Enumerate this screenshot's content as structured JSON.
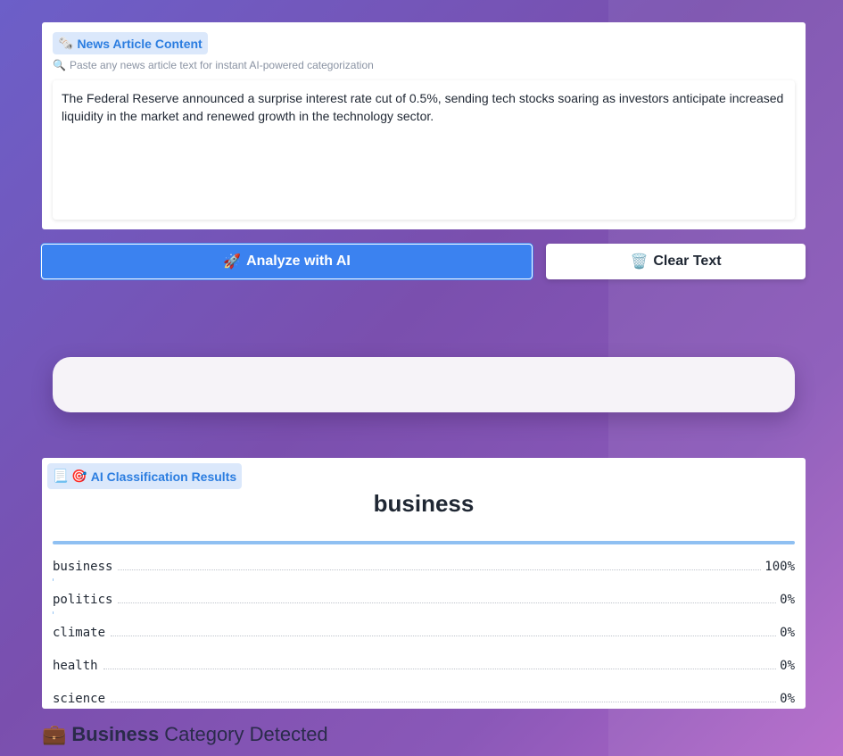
{
  "input": {
    "label_icon": "🗞️",
    "label": "News Article Content",
    "hint_icon": "🔍",
    "hint": "Paste any news article text for instant AI-powered categorization",
    "text": "The Federal Reserve announced a surprise interest rate cut of 0.5%, sending tech stocks soaring as investors anticipate increased liquidity in the market and renewed growth in the technology sector."
  },
  "actions": {
    "analyze_icon": "🚀",
    "analyze_label": "Analyze with AI",
    "clear_icon": "🗑️",
    "clear_label": "Clear Text"
  },
  "results": {
    "label_icons": "📃 🎯",
    "label": "AI Classification Results",
    "top_category": "business",
    "rows": [
      {
        "name": "business",
        "pct": "100%",
        "value": 1.0
      },
      {
        "name": "politics",
        "pct": "0%",
        "value": 0.0
      },
      {
        "name": "climate",
        "pct": "0%",
        "value": 0.0
      },
      {
        "name": "health",
        "pct": "0%",
        "value": 0.0
      },
      {
        "name": "science",
        "pct": "0%",
        "value": 0.0
      }
    ]
  },
  "footer": {
    "icon": "💼",
    "strong": "Business",
    "rest": "Category Detected"
  },
  "colors": {
    "accent": "#3b82f0",
    "bar": "#8fc0f2",
    "chip_bg": "#dbe8fb"
  }
}
